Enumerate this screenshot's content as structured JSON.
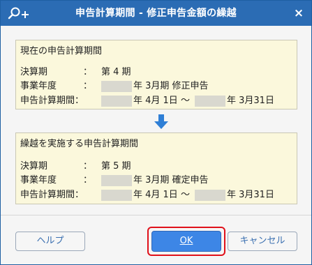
{
  "window": {
    "title": "申告計算期間 - 修正申告金額の繰越",
    "close_label": "×",
    "title_icon": "search-plus-icon",
    "colors": {
      "titlebar": "#2b6cb4",
      "panel_bg": "#fbf8dc",
      "ok_button": "#3d86e6",
      "highlight": "#e0101a"
    }
  },
  "current_period": {
    "heading": "現在の申告計算期間",
    "fiscal_term_label": "決算期",
    "fiscal_term_value": "第 4 期",
    "business_year_label": "事業年度",
    "business_year_value": "年 3月期 修正申告",
    "calc_period_label": "申告計算期間：",
    "calc_period_start": "年 4月 1日 ～",
    "calc_period_end": "年 3月31日",
    "colon": "："
  },
  "arrow_icon": "arrow-down-icon",
  "carryover_period": {
    "heading": "繰越を実施する申告計算期間",
    "fiscal_term_label": "決算期",
    "fiscal_term_value": "第 5 期",
    "business_year_label": "事業年度",
    "business_year_value": "年 3月期 確定申告",
    "calc_period_label": "申告計算期間：",
    "calc_period_start": "年 4月 1日 ～",
    "calc_period_end": "年 3月31日",
    "colon": "："
  },
  "buttons": {
    "help": "ヘルプ",
    "ok": "OK",
    "cancel": "キャンセル"
  }
}
